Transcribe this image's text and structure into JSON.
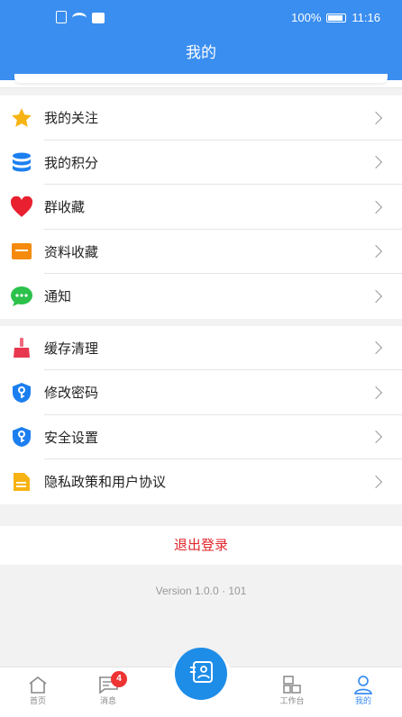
{
  "status": {
    "battery": "100%",
    "time": "11:16"
  },
  "header": {
    "title": "我的"
  },
  "menu_group_1": [
    {
      "label": "我的关注",
      "icon": "star-icon"
    },
    {
      "label": "我的积分",
      "icon": "database-icon"
    },
    {
      "label": "群收藏",
      "icon": "heart-icon"
    },
    {
      "label": "资料收藏",
      "icon": "folder-icon"
    },
    {
      "label": "通知",
      "icon": "chat-bubble-icon"
    }
  ],
  "menu_group_2": [
    {
      "label": "缓存清理",
      "icon": "broom-icon"
    },
    {
      "label": "修改密码",
      "icon": "key-shield-icon"
    },
    {
      "label": "安全设置",
      "icon": "key-shield-icon"
    },
    {
      "label": "隐私政策和用户协议",
      "icon": "document-icon"
    }
  ],
  "logout": {
    "label": "退出登录"
  },
  "version": "Version 1.0.0 · 101",
  "tabbar": {
    "home": "首页",
    "messages": "消息",
    "messages_badge": "4",
    "workbench": "工作台",
    "mine": "我的"
  },
  "colors": {
    "primary": "#3a8ef0",
    "logout": "#e0262b"
  }
}
